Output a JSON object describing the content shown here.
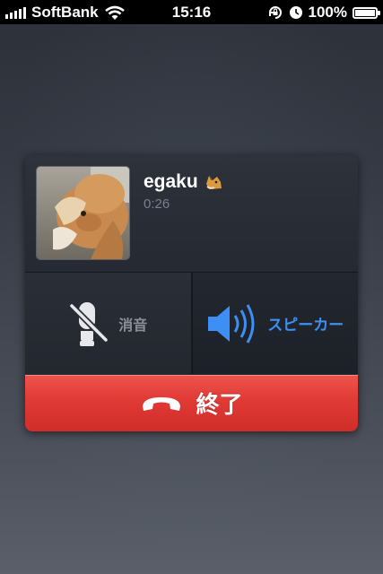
{
  "status_bar": {
    "carrier": "SoftBank",
    "time": "15:16",
    "battery": "100%",
    "battery_level": 1.0,
    "icons": [
      "signal-icon",
      "wifi-icon",
      "rotation-lock-icon",
      "alarm-icon",
      "battery-icon"
    ]
  },
  "call": {
    "contact_name": "egaku",
    "emoji": "dog-emoji-icon",
    "duration": "0:26"
  },
  "controls": {
    "mute_label": "消音",
    "speaker_label": "スピーカー",
    "end_label": "終了"
  },
  "colors": {
    "speaker_accent": "#3d8ff5",
    "end_button": "#e03a35"
  }
}
